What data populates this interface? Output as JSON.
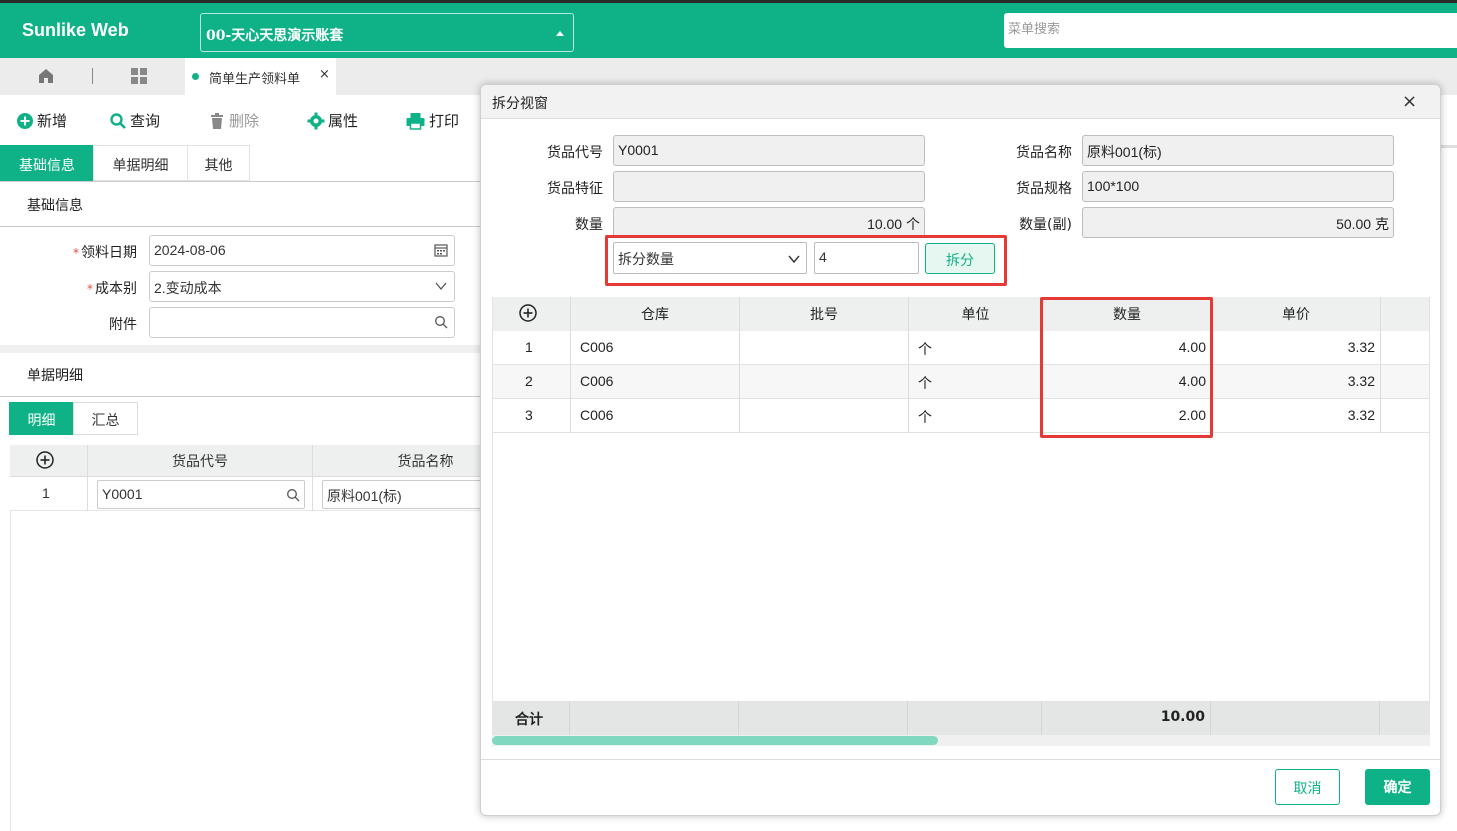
{
  "app": {
    "brand": "Sunlike Web",
    "account": "00-天心天思演示账套",
    "menu_search_placeholder": "菜单搜索"
  },
  "tabs": {
    "doc_tab": "简单生产领料单",
    "close": "×"
  },
  "toolbar": {
    "new": "新增",
    "query": "查询",
    "delete": "删除",
    "properties": "属性",
    "print": "打印"
  },
  "form_tabs": [
    "基础信息",
    "单据明细",
    "其他"
  ],
  "basic": {
    "section_title": "基础信息",
    "date_label": "领料日期",
    "date_value": "2024-08-06",
    "cost_label": "成本别",
    "cost_value": "2.变动成本",
    "attach_label": "附件",
    "required_mark": "*"
  },
  "detail": {
    "section_title": "单据明细",
    "subtabs": [
      "明细",
      "汇总"
    ],
    "columns": [
      "货品代号",
      "货品名称"
    ],
    "rows": [
      {
        "index": "1",
        "code": "Y0001",
        "name": "原料001(标)"
      }
    ]
  },
  "modal": {
    "title": "拆分视窗",
    "close": "×",
    "fields": {
      "code_label": "货品代号",
      "code_value": "Y0001",
      "name_label": "货品名称",
      "name_value": "原料001(标)",
      "feature_label": "货品特征",
      "feature_value": "",
      "spec_label": "货品规格",
      "spec_value": "100*100",
      "qty_label": "数量",
      "qty_value": "10.00 个",
      "qty2_label": "数量(副)",
      "qty2_value": "50.00 克"
    },
    "split": {
      "mode": "拆分数量",
      "count": "4",
      "button": "拆分"
    },
    "table": {
      "columns": [
        "仓库",
        "批号",
        "单位",
        "数量",
        "单价"
      ],
      "rows": [
        {
          "index": "1",
          "warehouse": "C006",
          "batch": "",
          "unit": "个",
          "qty": "4.00",
          "price": "3.32"
        },
        {
          "index": "2",
          "warehouse": "C006",
          "batch": "",
          "unit": "个",
          "qty": "4.00",
          "price": "3.32"
        },
        {
          "index": "3",
          "warehouse": "C006",
          "batch": "",
          "unit": "个",
          "qty": "2.00",
          "price": "3.32"
        }
      ],
      "total_label": "合计",
      "total_qty": "10.00"
    },
    "cancel": "取消",
    "ok": "确定"
  },
  "colors": {
    "accent": "#0fb187",
    "highlight": "#e53935"
  }
}
